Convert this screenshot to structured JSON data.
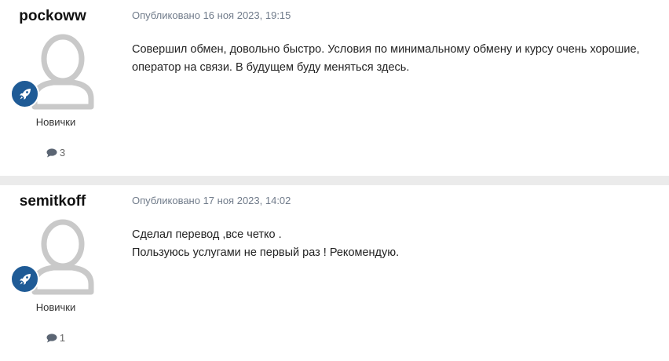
{
  "posts": [
    {
      "author": "pockoww",
      "rank": "Новички",
      "post_count": "3",
      "meta": "Опубликовано 16 ноя 2023, 19:15",
      "content": [
        "Совершил обмен, довольно быстро. Условия по минимальному обмену и курсу очень хорошие,",
        "оператор на связи. В будущем буду меняться здесь."
      ]
    },
    {
      "author": "semitkoff",
      "rank": "Новички",
      "post_count": "1",
      "meta": "Опубликовано 17 ноя 2023, 14:02",
      "content": [
        "Сделал перевод ,все четко .",
        "Пользуюсь услугами не первый раз ! Рекомендую."
      ]
    }
  ],
  "icons": {
    "avatar": "default-user-avatar-icon",
    "rank": "rocket-icon",
    "post_count": "chat-bubble-icon"
  },
  "colors": {
    "rank_badge": "#1f5b96",
    "meta_text": "#707b8a",
    "separator": "#ebebeb",
    "avatar_gray": "#c9c9c9"
  }
}
